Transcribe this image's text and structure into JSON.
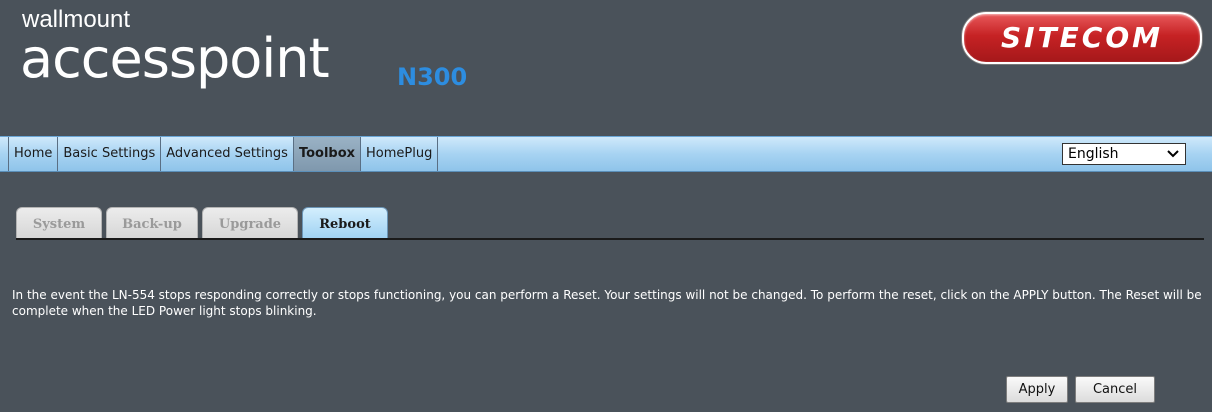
{
  "header": {
    "brand_small": "wallmount",
    "brand_big": "accesspoint",
    "brand_model": "N300",
    "logo_text": "SITECOM"
  },
  "nav": {
    "items": [
      "Home",
      "Basic Settings",
      "Advanced Settings",
      "Toolbox",
      "HomePlug"
    ],
    "active": "Toolbox",
    "language": "English",
    "language_arrow": "chevron-down-icon"
  },
  "tabs": {
    "items": [
      "System",
      "Back-up",
      "Upgrade",
      "Reboot"
    ],
    "active": "Reboot"
  },
  "content": {
    "description": "In the event the LN-554 stops responding correctly or stops functioning, you can perform a Reset. Your settings will not be changed. To perform the reset, click on the APPLY button. The Reset will be complete when the LED Power light stops blinking."
  },
  "buttons": {
    "apply": "Apply",
    "cancel": "Cancel"
  },
  "colors": {
    "background": "#4a525a",
    "nav_bar": "#a7d3f2",
    "logo_red": "#c62224",
    "model_blue": "#2d8de0"
  }
}
